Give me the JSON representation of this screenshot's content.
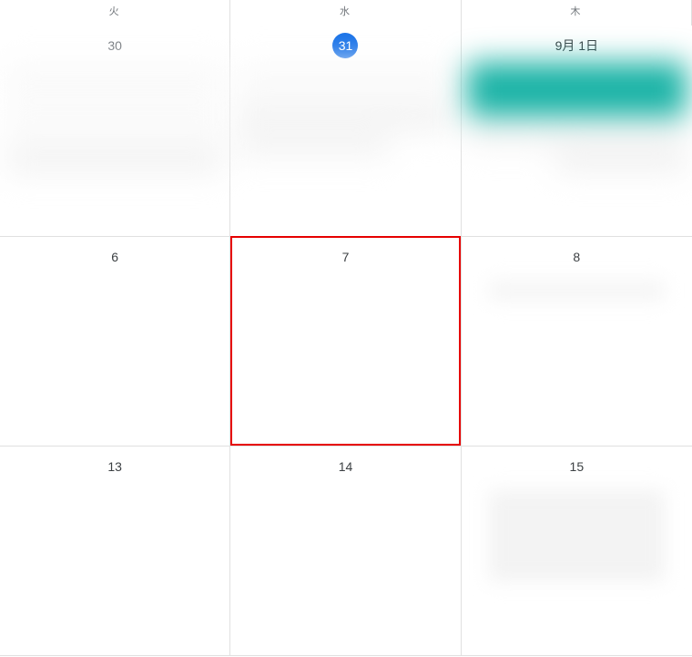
{
  "headers": {
    "tue": "火",
    "wed": "水",
    "thu": "木"
  },
  "rows": [
    {
      "tue": {
        "date": "30",
        "muted": true,
        "today": false
      },
      "wed": {
        "date": "31",
        "muted": false,
        "today": true
      },
      "thu": {
        "date": "9月 1日",
        "muted": false,
        "today": false,
        "monthFirst": true
      }
    },
    {
      "tue": {
        "date": "6",
        "muted": false,
        "today": false
      },
      "wed": {
        "date": "7",
        "muted": false,
        "today": false,
        "highlighted": true
      },
      "thu": {
        "date": "8",
        "muted": false,
        "today": false
      }
    },
    {
      "tue": {
        "date": "13",
        "muted": false,
        "today": false
      },
      "wed": {
        "date": "14",
        "muted": false,
        "today": false
      },
      "thu": {
        "date": "15",
        "muted": false,
        "today": false
      }
    }
  ],
  "colors": {
    "today_badge": "#1a73e8",
    "highlight_border": "#e60000",
    "event_teal": "#1ab3a6"
  }
}
